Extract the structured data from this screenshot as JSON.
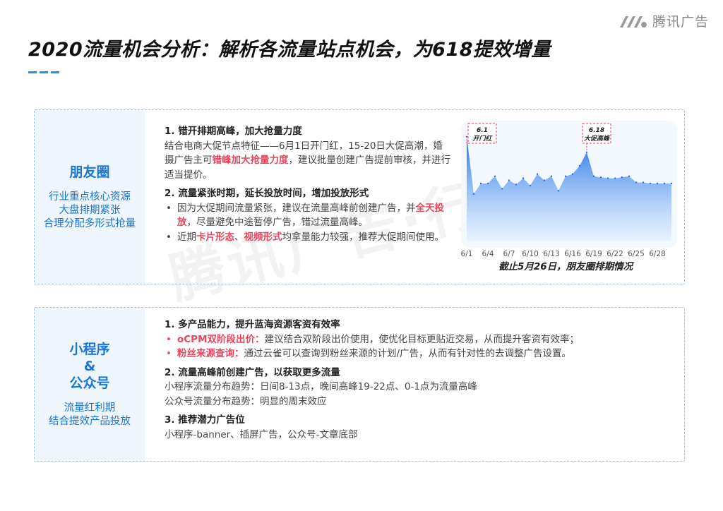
{
  "brand": {
    "logo_text": "腾讯广告"
  },
  "title": "2020流量机会分析：解析各流量站点机会，为618提效增量",
  "moments": {
    "name": "朋友圈",
    "sub_lines": [
      "行业重点核心资源",
      "大盘排期紧张",
      "合理分配多形式抢量"
    ],
    "point1": {
      "heading": "1. 错开排期高峰，加大抢量力度",
      "text_a": "结合电商大促节点特征——6月1日开门红，15-20日大促高潮，婚摄广告主可",
      "highlight": "错峰加大抢量力度",
      "text_b": "，建议批量创建广告提前审核，并进行适当提价。"
    },
    "point2": {
      "heading": "2. 流量紧张时期，延长投放时间，增加投放形式",
      "b1_a": "因为大促期间流量紧张，建议在流量高峰前创建广告，并",
      "b1_hl": "全天投放",
      "b1_b": "，尽量避免中途暂停广告，错过流量高峰。",
      "b2_a": "近期",
      "b2_hl1": "卡片形态",
      "b2_sep": "、",
      "b2_hl2": "视频形式",
      "b2_b": "均拿量能力较强，推荐大促期间使用。"
    },
    "chart_caption": "截止5月26日，朋友圈排期情况"
  },
  "chart_data": {
    "type": "area",
    "x": [
      "6/1",
      "6/2",
      "6/3",
      "6/4",
      "6/5",
      "6/6",
      "6/7",
      "6/8",
      "6/9",
      "6/10",
      "6/11",
      "6/12",
      "6/13",
      "6/14",
      "6/15",
      "6/16",
      "6/17",
      "6/18",
      "6/19",
      "6/20",
      "6/21",
      "6/22",
      "6/23",
      "6/24",
      "6/25",
      "6/26",
      "6/27",
      "6/28",
      "6/29",
      "6/30"
    ],
    "tick_labels": [
      "6/1",
      "6/4",
      "6/7",
      "6/10",
      "6/13",
      "6/16",
      "6/19",
      "6/22",
      "6/25",
      "6/28"
    ],
    "values": [
      100,
      45,
      55,
      55,
      62,
      50,
      58,
      54,
      60,
      53,
      64,
      58,
      62,
      48,
      62,
      64,
      72,
      85,
      62,
      61,
      60,
      60,
      61,
      62,
      56,
      56,
      55,
      55,
      55,
      55
    ],
    "ylim": [
      0,
      110
    ],
    "color": "#1f6fe6",
    "annotations": [
      {
        "x": "6/1",
        "label_top": "6.1",
        "label_bottom": "开门红"
      },
      {
        "x": "6/18",
        "label_top": "6.18",
        "label_bottom": "大促高峰"
      }
    ]
  },
  "miniprogram": {
    "name_lines": [
      "小程序",
      "&",
      "公众号"
    ],
    "sub_lines": [
      "流量红利期",
      "结合提效产品投放"
    ],
    "point1": {
      "heading": "1. 多产品能力，提升蓝海资源客资有效率",
      "b1_hl": "oCPM双阶段出价：",
      "b1_text": "建议结合双阶段出价使用，使优化目标更贴近交易，从而提升客资有效率；",
      "b2_hl": "粉丝来源查询：",
      "b2_text": "通过云雀可以查询到粉丝来源的计划/广告，从而有针对性的去调整广告设置。"
    },
    "point2": {
      "heading": "2. 流量高峰前创建广告，以获取更多流量",
      "line1": "小程序流量分布趋势：日间8-13点，晚间高峰19-22点、0-1点为流量高峰",
      "line2": "公众号流量分布趋势：明显的周末效应"
    },
    "point3": {
      "heading": "3. 推荐潜力广告位",
      "line1": "小程序-banner、插屏广告，公众号-文章底部"
    }
  }
}
